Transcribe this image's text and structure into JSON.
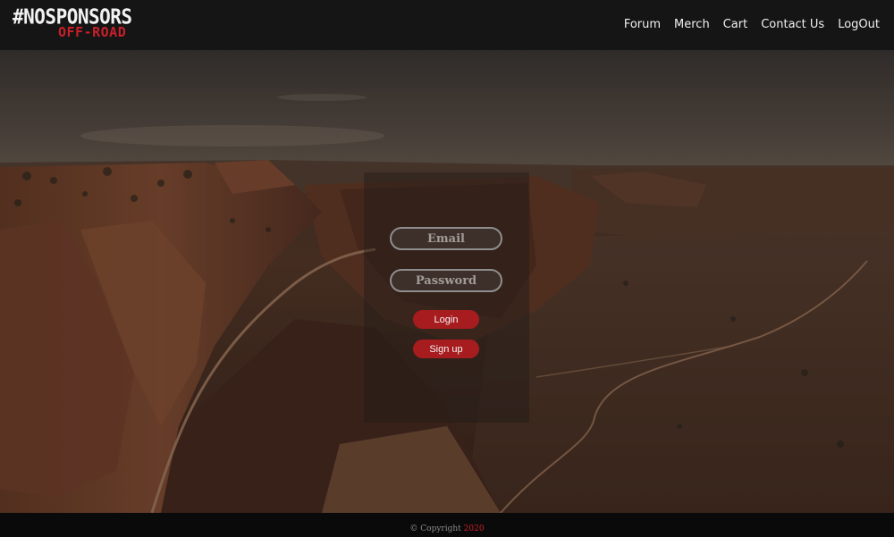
{
  "brand": {
    "name": "#NOSPONSORS",
    "tagline": "OFF-ROAD"
  },
  "nav": {
    "items": [
      {
        "id": "forum",
        "label": "Forum"
      },
      {
        "id": "merch",
        "label": "Merch"
      },
      {
        "id": "cart",
        "label": "Cart"
      },
      {
        "id": "contact",
        "label": "Contact Us"
      },
      {
        "id": "logout",
        "label": "LogOut"
      }
    ]
  },
  "login": {
    "email_placeholder": "Email",
    "password_placeholder": "Password",
    "login_label": "Login",
    "signup_label": "Sign up"
  },
  "footer": {
    "copyright_text": "© Copyright",
    "year": "2020"
  },
  "colors": {
    "accent": "#a71c1f",
    "header_bg": "#151515",
    "footer_bg": "#0a0a0a"
  }
}
